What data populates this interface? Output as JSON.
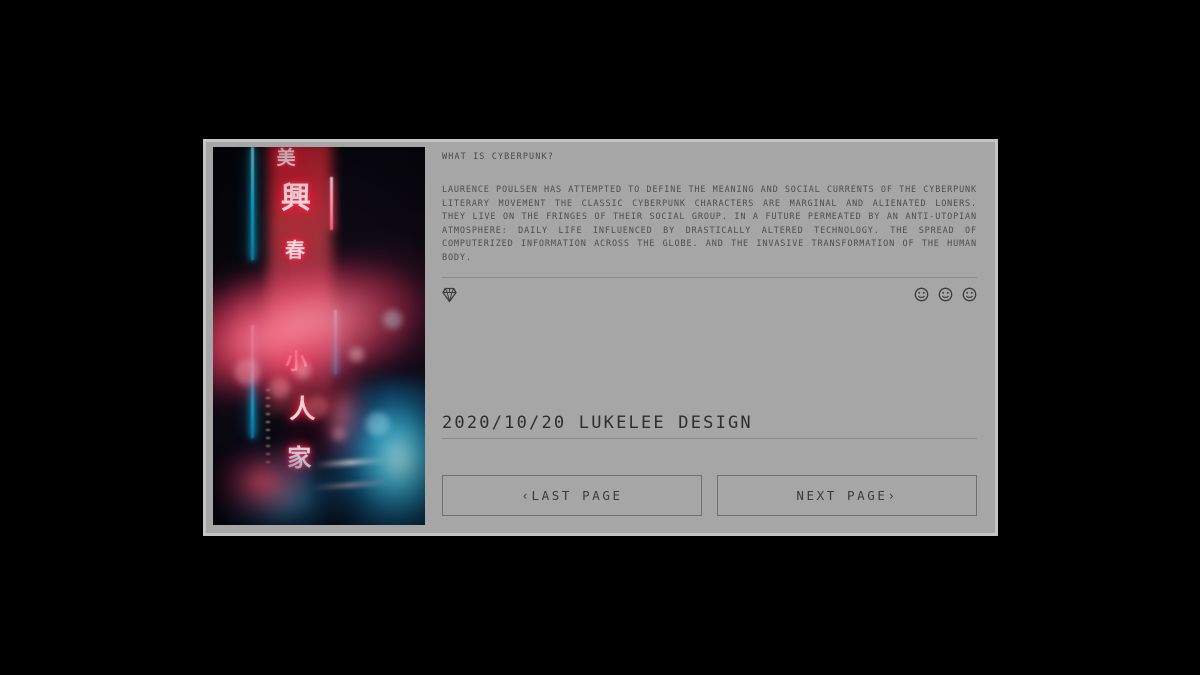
{
  "page": {
    "background_color": "#000000",
    "card_background_color": "#a6a6a6",
    "card_border_color": "#c4c4c4",
    "text_color": "#4d4d4d"
  },
  "article": {
    "heading": "WHAT IS CYBERPUNK?",
    "body": "LAURENCE  POULSEN HAS ATTEMPTED TO DEFINE  THE MEANING AND SOCIAL CURRENTS OF THE CYBERPUNK  LITERARY MOVEMENT THE CLASSIC CYBERPUNK CHARACTERS ARE MARGINAL AND ALIENATED LONERS. THEY LIVE ON THE FRINGES OF THEIR SOCIAL GROUP. IN A FUTURE PERMEATED BY AN ANTI-UTOPIAN ATMOSPHERE:  DAILY LIFE INFLUENCED BY DRASTICALLY  ALTERED  TECHNOLOGY.  THE SPREAD  OF COMPUTERIZED INFORMATION ACROSS THE GLOBE.  AND THE INVASIVE TRANSFORMATION OF THE HUMAN BODY."
  },
  "meta": {
    "date": "2020/10/20",
    "author": "LUKELEE DESIGN",
    "byline": "2020/10/20 LUKELEE DESIGN"
  },
  "icons": {
    "left": {
      "name": "diamond-icon",
      "label": "DIAMOND"
    },
    "right": [
      {
        "name": "smiley-icon-1",
        "label": "SMILEY"
      },
      {
        "name": "smiley-icon-2",
        "label": "SMILEY"
      },
      {
        "name": "smiley-icon-3",
        "label": "SMILEY"
      }
    ]
  },
  "pagination": {
    "previous_label": "‹LAST PAGE",
    "next_label": "NEXT PAGE›"
  },
  "photo": {
    "name": "cyberpunk-neon-street-photo",
    "alt": "Neon-lit night street with glowing CJK signage, pink light flare and cyan neon",
    "glyphs": [
      "美",
      "興",
      "春",
      "小",
      "人",
      "家"
    ]
  }
}
